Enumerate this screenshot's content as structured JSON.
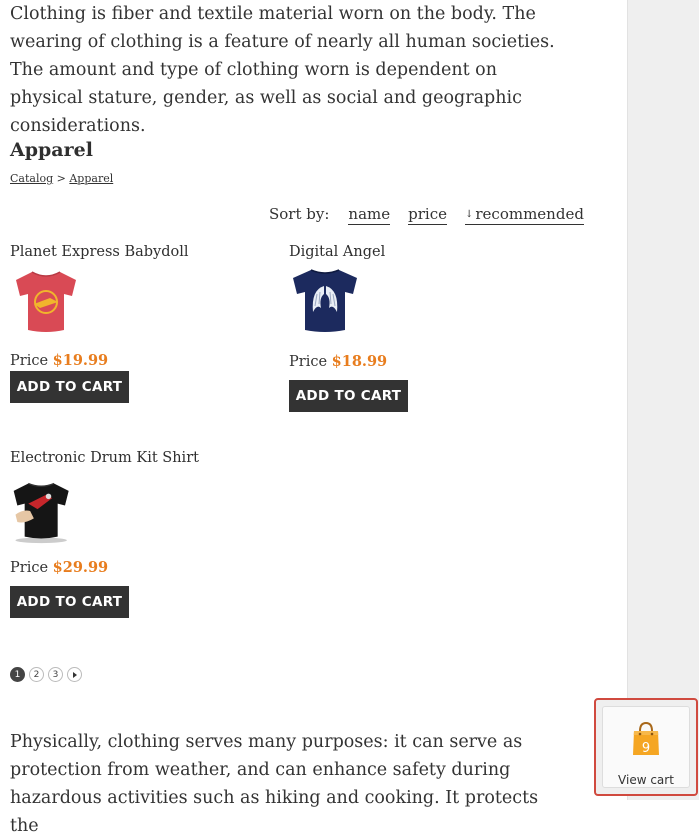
{
  "intro_text": "Clothing is fiber and textile material worn on the body. The wearing of clothing is a feature of nearly all human societies. The amount and type of clothing worn is dependent on physical stature, gender, as well as social and geographic considerations.",
  "category": {
    "title": "Apparel",
    "breadcrumb": {
      "root": "Catalog",
      "separator": ">",
      "current": "Apparel"
    }
  },
  "sort": {
    "label": "Sort by:",
    "options": [
      "name",
      "price",
      "recommended"
    ],
    "active": "recommended"
  },
  "products": [
    {
      "name": "Planet Express Babydoll",
      "price_label": "Price",
      "price": "$19.99",
      "button": "ADD TO CART",
      "shirt_color": "#d94a55",
      "print": "planet-express-logo"
    },
    {
      "name": "Digital Angel",
      "price_label": "Price",
      "price": "$18.99",
      "button": "ADD TO CART",
      "shirt_color": "#1c2a5e",
      "print": "angel-wings"
    },
    {
      "name": "Electronic Drum Kit Shirt",
      "price_label": "Price",
      "price": "$29.99",
      "button": "ADD TO CART",
      "shirt_color": "#151515",
      "print": "drum-kit"
    }
  ],
  "pagination": {
    "pages": [
      "1",
      "2",
      "3"
    ],
    "current": "1",
    "next_icon": "next-arrow-icon"
  },
  "outro_text": "Physically, clothing serves many purposes: it can serve as protection from weather, and can enhance safety during hazardous activities such as hiking and cooking. It protects the",
  "cart": {
    "count": "9",
    "label": "View cart",
    "icon": "shopping-bag-icon",
    "bag_color": "#f5a623"
  },
  "colors": {
    "accent_price": "#e87d1e",
    "button_bg": "#333333",
    "highlight_border": "#d04a3f",
    "sidebar_bg": "#efefef"
  }
}
